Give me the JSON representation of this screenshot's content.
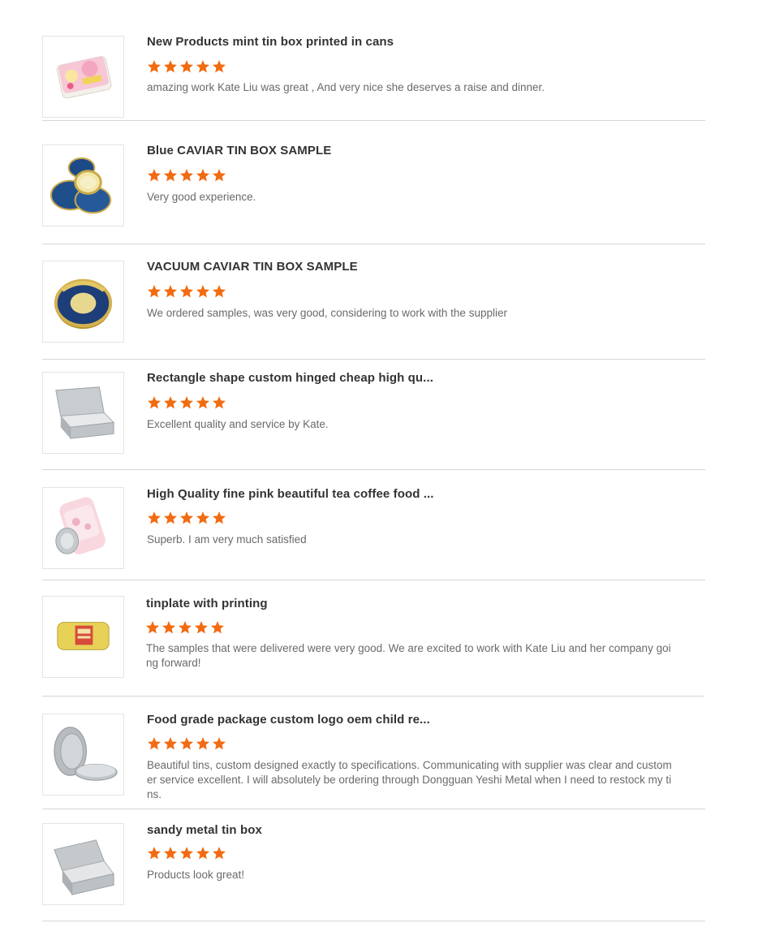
{
  "accent_star_color": "#f26b12",
  "reviews": [
    {
      "title": "New Products mint tin box printed in cans",
      "rating": 5,
      "text": "amazing work Kate Liu was great , And very nice she deserves a raise and dinner.",
      "image": "pink-printed-mint-tin"
    },
    {
      "title": "Blue CAVIAR TIN BOX SAMPLE",
      "rating": 5,
      "text": "Very good experience.",
      "image": "blue-caviar-tins"
    },
    {
      "title": "VACUUM CAVIAR TIN BOX SAMPLE",
      "rating": 5,
      "text": "We ordered samples, was very good, considering to work with the supplier",
      "image": "gold-caviar-tin"
    },
    {
      "title": "Rectangle shape custom hinged cheap high qu...",
      "rating": 5,
      "text": "Excellent quality and service by Kate.",
      "image": "hinged-rectangle-tin"
    },
    {
      "title": "High Quality fine pink beautiful tea coffee food ...",
      "rating": 5,
      "text": "Superb. I am very much satisfied",
      "image": "pink-tea-jar"
    },
    {
      "title": "tinplate with printing",
      "rating": 5,
      "text": "The samples that were delivered were very good.  We are excited to work with Kate Liu and her company going forward!",
      "image": "yellow-printed-tin"
    },
    {
      "title": "Food grade package custom logo oem child re...",
      "rating": 5,
      "text": "Beautiful tins, custom designed exactly to specifications. Communicating with supplier was clear and customer service excellent. I will absolutely be ordering through Dongguan Yeshi Metal when I need to restock my tins.",
      "image": "round-window-tin"
    },
    {
      "title": "sandy metal tin box",
      "rating": 5,
      "text": "Products look great!",
      "image": "sandy-metal-tin"
    }
  ]
}
